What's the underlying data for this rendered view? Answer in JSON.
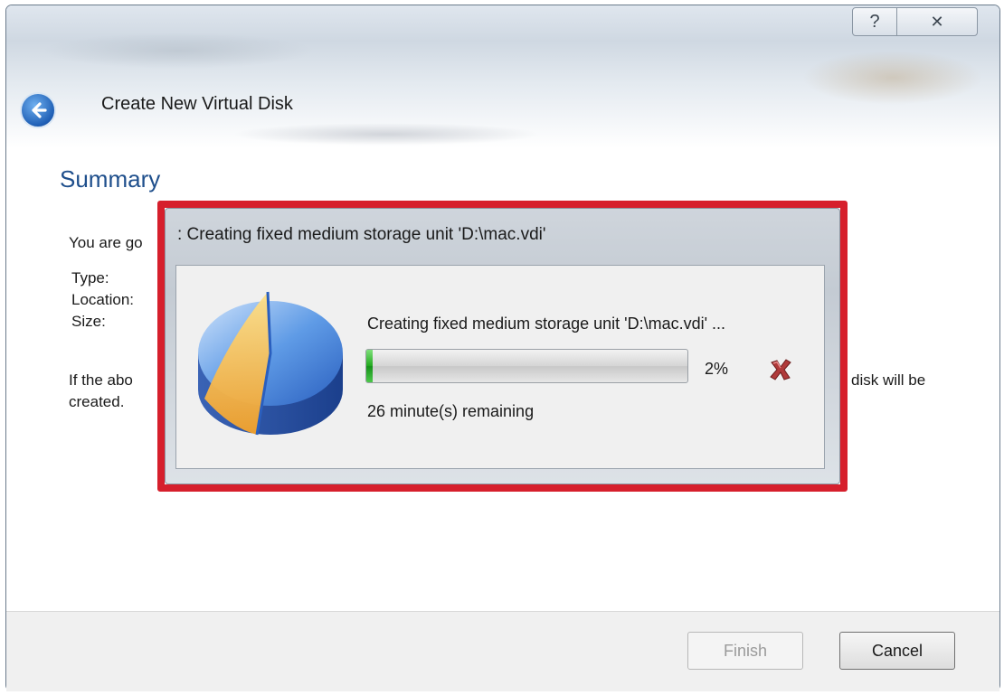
{
  "window": {
    "title": "Create New Virtual Disk",
    "help_glyph": "?",
    "close_glyph": "✕"
  },
  "summary": {
    "heading": "Summary",
    "intro_partial": "You are go",
    "labels": {
      "type": "Type:",
      "location": "Location:",
      "size": "Size:"
    },
    "confirm_partial_left": "If the abo",
    "confirm_partial_right": "disk will be",
    "confirm_second_line": "created."
  },
  "progress_dialog": {
    "title": ": Creating fixed medium storage unit 'D:\\mac.vdi'",
    "status": "Creating fixed medium storage unit 'D:\\mac.vdi' ...",
    "progress_value": 0.02,
    "progress_label": "2%",
    "remaining": "26 minute(s) remaining",
    "highlight_color": "#d61f2c"
  },
  "footer": {
    "finish_label": "Finish",
    "cancel_label": "Cancel"
  },
  "icons": [
    "help-icon",
    "close-icon",
    "back-arrow-icon",
    "disk-pie-icon",
    "cancel-operation-icon"
  ]
}
